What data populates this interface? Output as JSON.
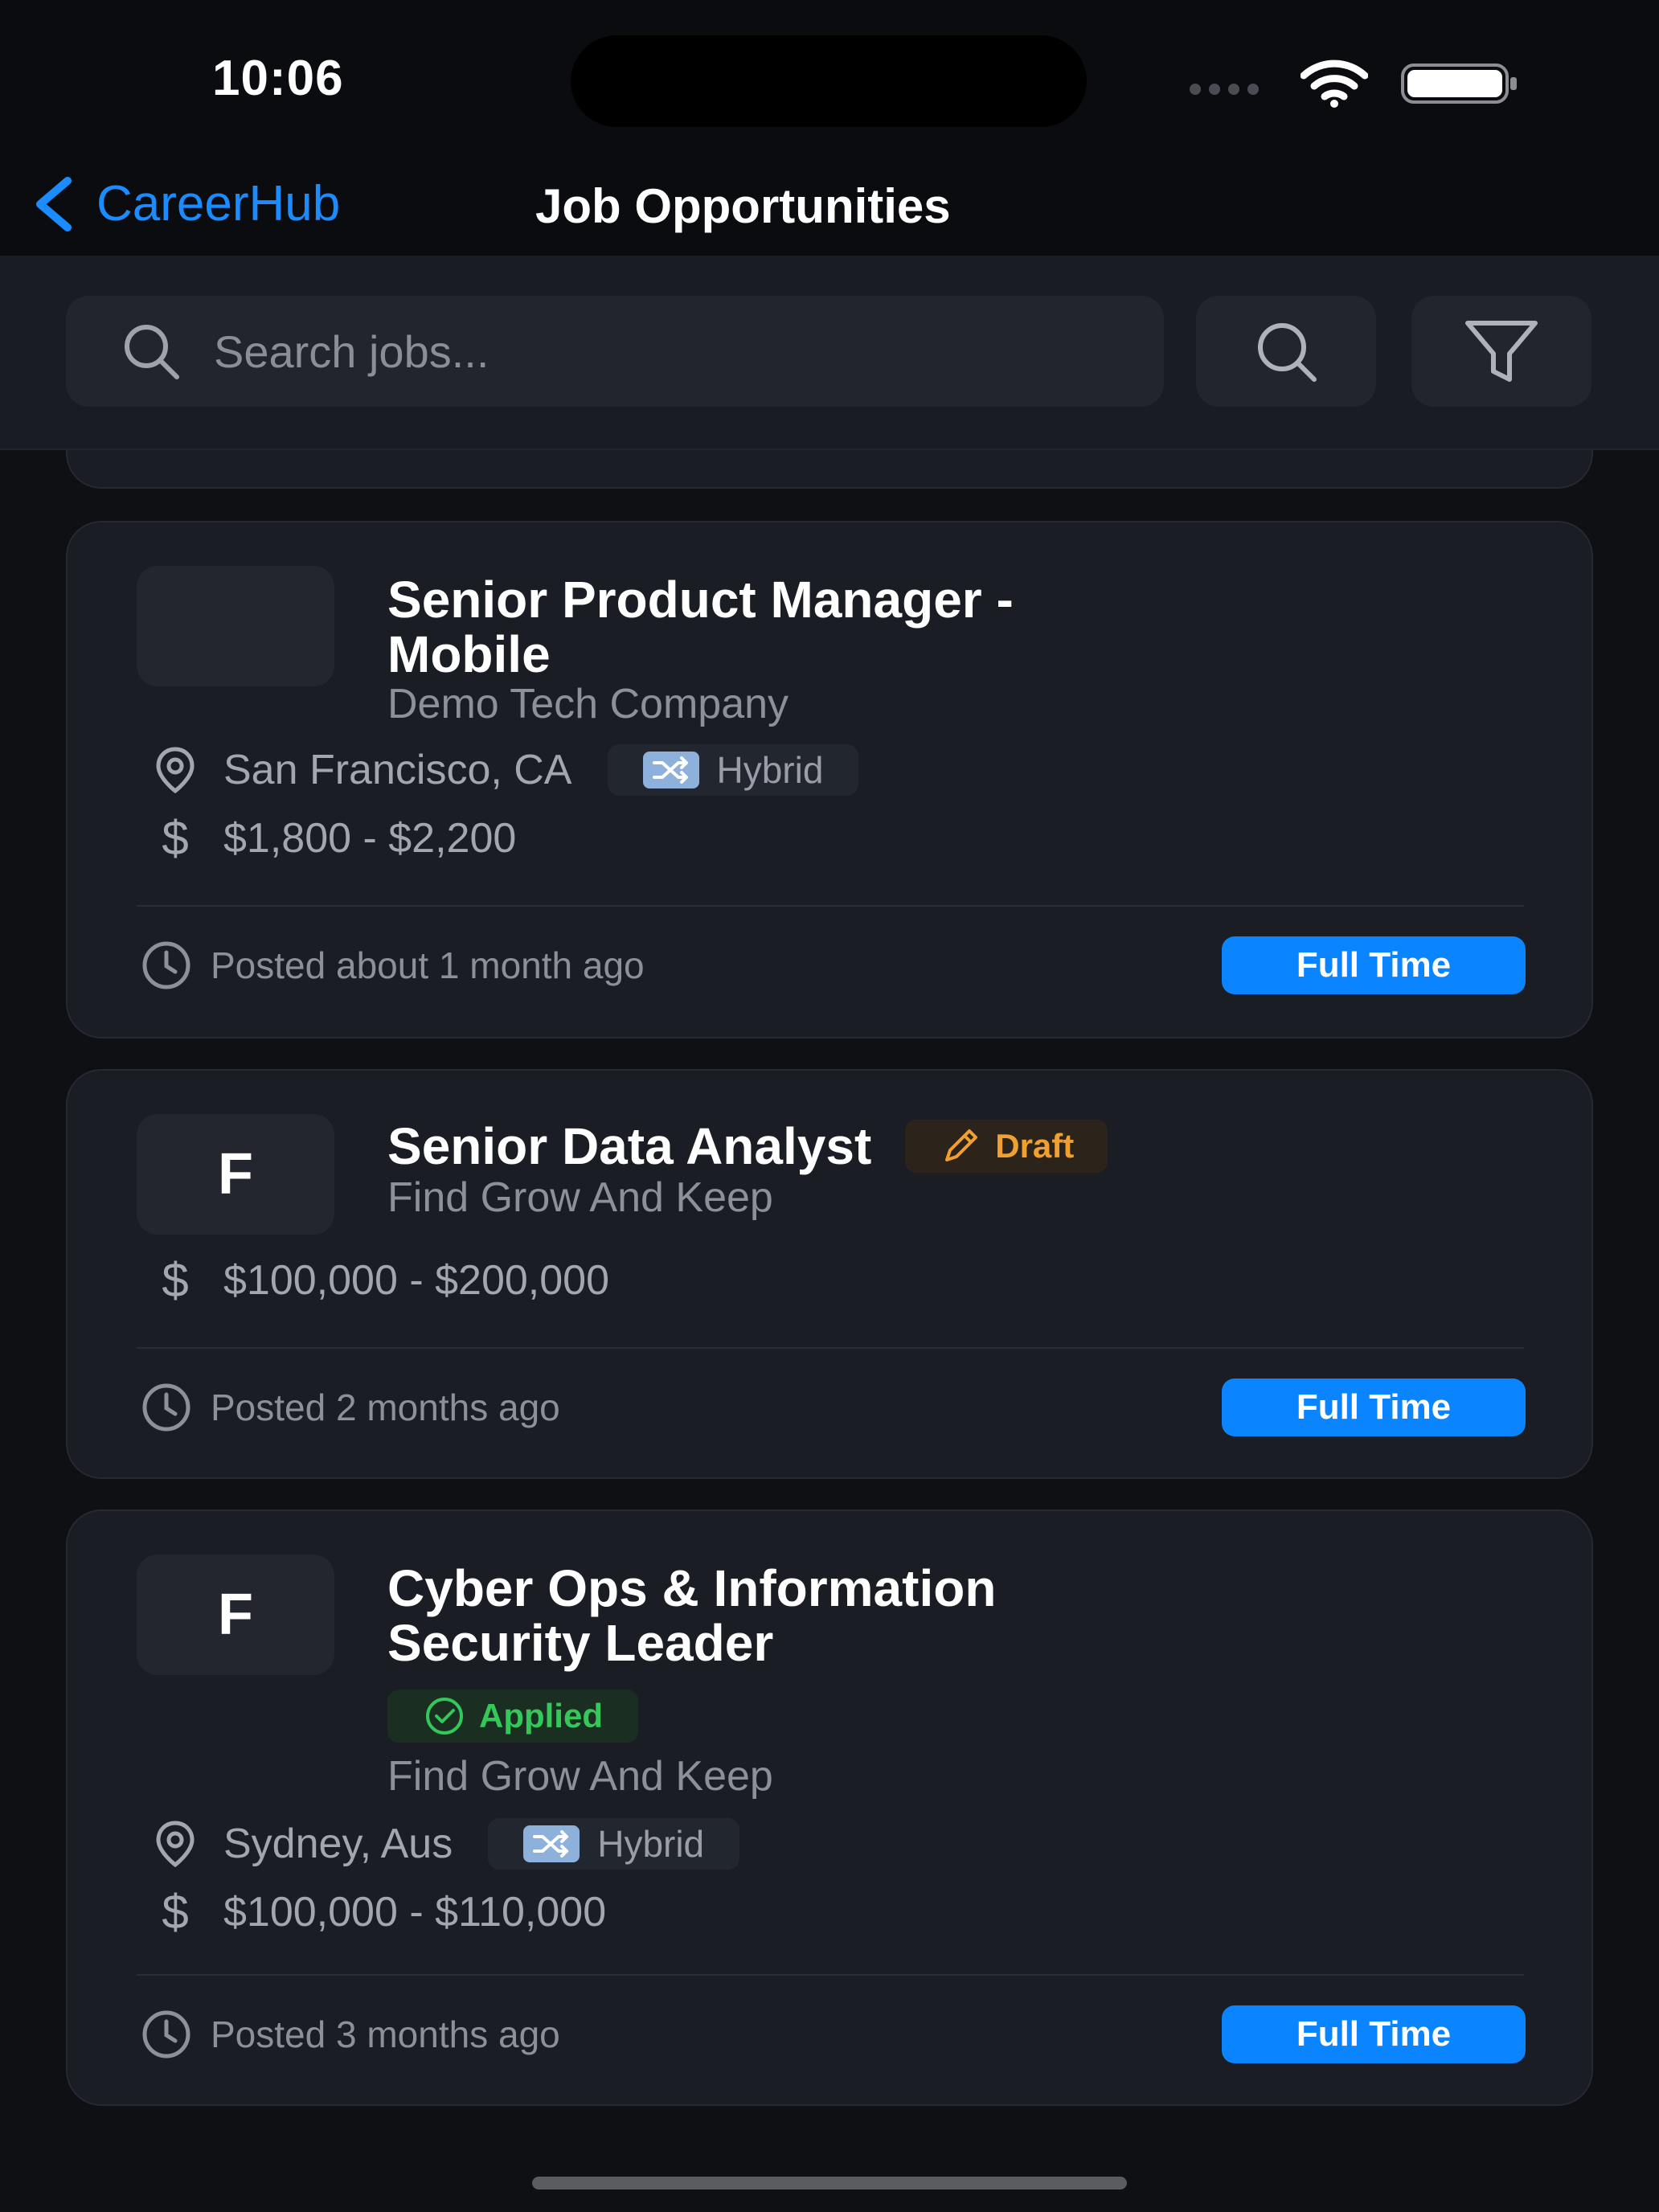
{
  "status_bar": {
    "time": "10:06"
  },
  "nav": {
    "back_label": "CareerHub",
    "title": "Job Opportunities"
  },
  "search": {
    "placeholder": "Search jobs..."
  },
  "jobs": [
    {
      "logo_letter": "",
      "title_line1": "Senior Product Manager -",
      "title_line2": "Mobile",
      "company": "Demo Tech Company",
      "location": "San Francisco, CA",
      "work_mode": "Hybrid",
      "salary": "$1,800 - $2,200",
      "posted": "Posted about 1 month ago",
      "job_type": "Full Time"
    },
    {
      "logo_letter": "F",
      "title_line1": "Senior Data Analyst",
      "badge": "Draft",
      "company": "Find Grow And Keep",
      "salary": "$100,000 - $200,000",
      "posted": "Posted 2 months ago",
      "job_type": "Full Time"
    },
    {
      "logo_letter": "F",
      "title_line1": "Cyber Ops & Information",
      "title_line2": "Security Leader",
      "badge": "Applied",
      "company": "Find Grow And Keep",
      "location": "Sydney, Aus",
      "work_mode": "Hybrid",
      "salary": "$100,000 - $110,000",
      "posted": "Posted 3 months ago",
      "job_type": "Full Time"
    }
  ],
  "colors": {
    "background": "#0f1014",
    "card": "#1b1d24",
    "accent": "#0a84ff",
    "draft": "#f0a030",
    "applied": "#34c759"
  },
  "icons": [
    "chevron-left-icon",
    "search-icon",
    "filter-icon",
    "location-pin-icon",
    "dollar-icon",
    "shuffle-icon",
    "clock-icon",
    "pencil-icon",
    "check-circle-icon",
    "wifi-icon",
    "battery-icon"
  ]
}
